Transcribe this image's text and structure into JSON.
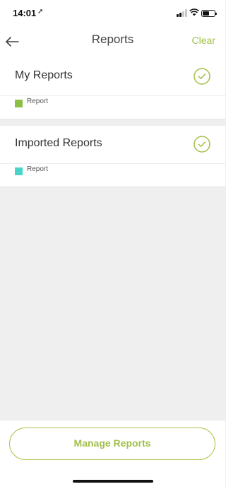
{
  "status": {
    "time": "14:01"
  },
  "nav": {
    "title": "Reports",
    "clear_label": "Clear"
  },
  "colors": {
    "accent": "#a2c04a",
    "my_reports_tag": "#8bbf45",
    "imported_reports_tag": "#4ad3c9"
  },
  "sections": [
    {
      "title": "My Reports",
      "tag_label": "Report",
      "selected": true
    },
    {
      "title": "Imported Reports",
      "tag_label": "Report",
      "selected": true
    }
  ],
  "footer": {
    "manage_label": "Manage Reports"
  }
}
